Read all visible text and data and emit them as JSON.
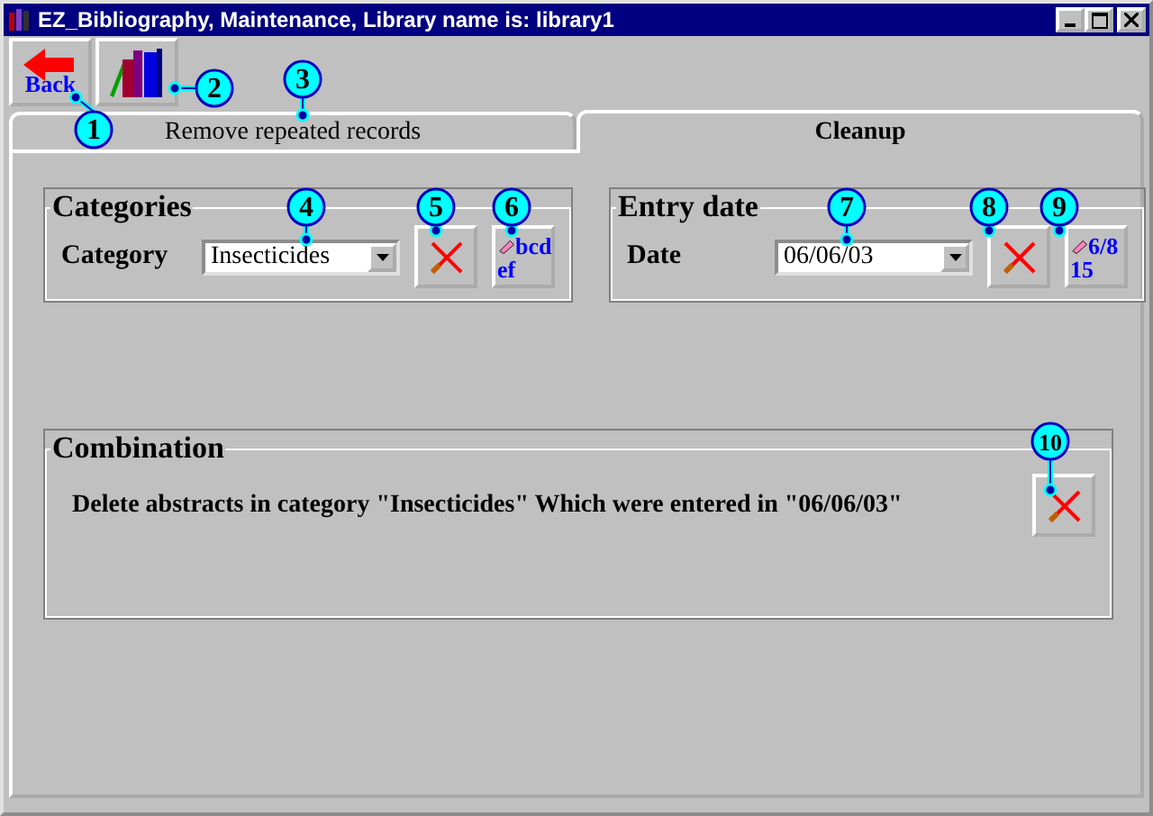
{
  "window": {
    "title": "EZ_Bibliography, Maintenance, Library name is: library1"
  },
  "toolbar": [
    {
      "kind": "back",
      "label": "Back"
    },
    {
      "kind": "books"
    }
  ],
  "tabs": [
    {
      "label": "Remove repeated records",
      "selected": false
    },
    {
      "label": "Cleanup",
      "selected": true
    }
  ],
  "categories": {
    "title": "Categories",
    "label": "Category",
    "value": "Insecticides",
    "icon_text": [
      "bcd",
      "ef"
    ]
  },
  "entry_date": {
    "title": "Entry date",
    "label": "Date",
    "value": "06/06/03",
    "icon_text": [
      "6/8",
      "15"
    ]
  },
  "combination": {
    "title": "Combination",
    "text": "Delete abstracts in category \"Insecticides\" Which were entered in \"06/06/03\""
  },
  "callouts": [
    {
      "number": "1"
    },
    {
      "number": "2"
    },
    {
      "number": "3"
    },
    {
      "number": "4"
    },
    {
      "number": "5"
    },
    {
      "number": "6"
    },
    {
      "number": "7"
    },
    {
      "number": "8"
    },
    {
      "number": "9"
    },
    {
      "number": "10"
    }
  ]
}
